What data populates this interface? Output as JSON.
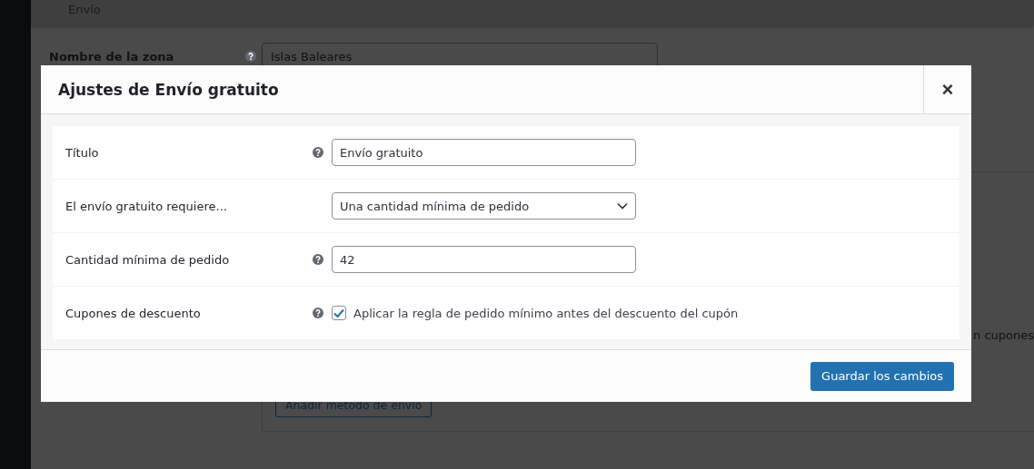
{
  "page": {
    "heading": "Envío",
    "zone_name": {
      "label": "Nombre de la zona",
      "value": "Islas Baleares"
    },
    "partial_text": "n cupones",
    "add_method_button": "Añadir método de envío"
  },
  "modal": {
    "title": "Ajustes de Envío gratuito",
    "close": "×",
    "fields": [
      {
        "kind": "text",
        "label": "Título",
        "help": true,
        "value": "Envío gratuito"
      },
      {
        "kind": "select",
        "label": "El envío gratuito requiere...",
        "help": false,
        "value": "Una cantidad mínima de pedido"
      },
      {
        "kind": "text",
        "label": "Cantidad mínima de pedido",
        "help": true,
        "value": "42"
      },
      {
        "kind": "checkbox",
        "label": "Cupones de descuento",
        "help": true,
        "checked": true,
        "text": "Aplicar la regla de pedido mínimo antes del descuento del cupón"
      }
    ],
    "save_button": "Guardar los cambios"
  }
}
